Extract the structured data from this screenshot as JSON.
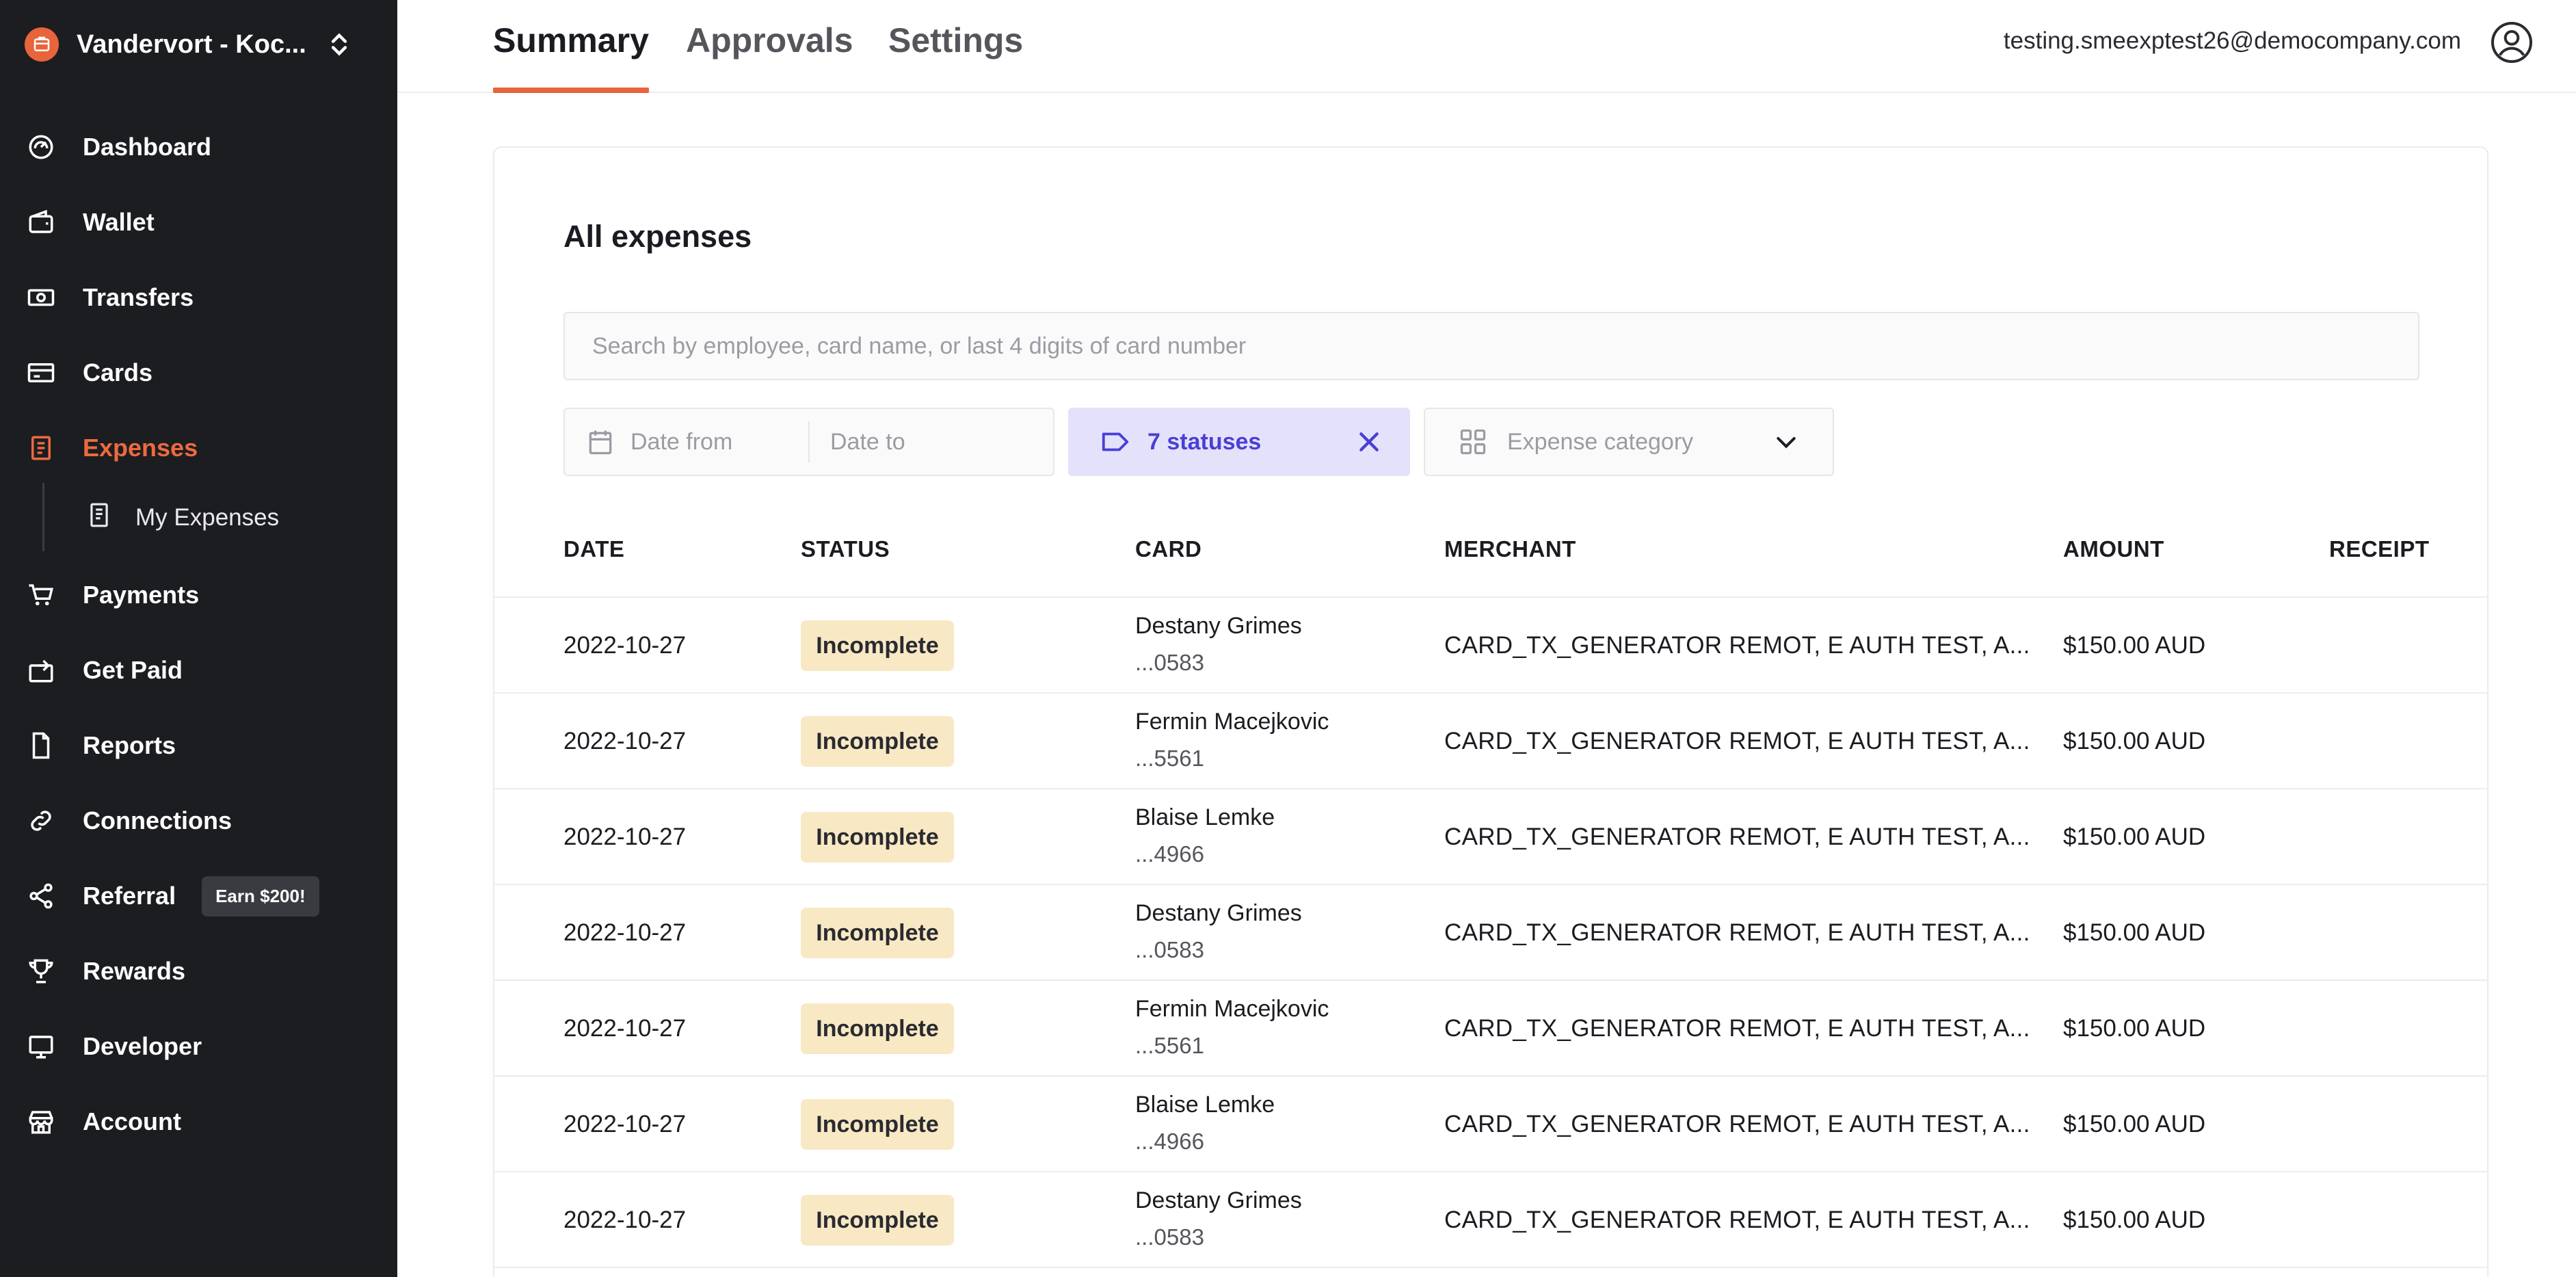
{
  "org": {
    "name": "Vandervort - Koc..."
  },
  "nav": [
    {
      "label": "Dashboard",
      "icon": "dashboard-icon"
    },
    {
      "label": "Wallet",
      "icon": "wallet-icon"
    },
    {
      "label": "Transfers",
      "icon": "transfers-icon"
    },
    {
      "label": "Cards",
      "icon": "cards-icon"
    },
    {
      "label": "Expenses",
      "icon": "expenses-icon",
      "active": true
    },
    {
      "label": "Payments",
      "icon": "cart-icon"
    },
    {
      "label": "Get Paid",
      "icon": "get-paid-icon"
    },
    {
      "label": "Reports",
      "icon": "reports-icon"
    },
    {
      "label": "Connections",
      "icon": "link-icon"
    },
    {
      "label": "Referral",
      "icon": "share-icon"
    },
    {
      "label": "Rewards",
      "icon": "trophy-icon"
    },
    {
      "label": "Developer",
      "icon": "monitor-icon"
    },
    {
      "label": "Account",
      "icon": "store-icon"
    }
  ],
  "subnav": {
    "my_expenses": "My Expenses"
  },
  "referral_badge": "Earn $200!",
  "tabs": {
    "summary": "Summary",
    "approvals": "Approvals",
    "settings": "Settings"
  },
  "user": {
    "email": "testing.smeexptest26@democompany.com"
  },
  "page": {
    "title": "All expenses"
  },
  "search": {
    "placeholder": "Search by employee, card name, or last 4 digits of card number"
  },
  "filters": {
    "date_from": "Date from",
    "date_to": "Date to",
    "statuses": "7 statuses",
    "category": "Expense category"
  },
  "table": {
    "headers": {
      "date": "DATE",
      "status": "STATUS",
      "card": "CARD",
      "merchant": "MERCHANT",
      "amount": "AMOUNT",
      "receipt": "RECEIPT"
    },
    "rows": [
      {
        "date": "2022-10-27",
        "status": "Incomplete",
        "card_name": "Destany Grimes",
        "card_num": "...0583",
        "merchant": "CARD_TX_GENERATOR REMOT, E AUTH TEST, A...",
        "amount": "$150.00 AUD"
      },
      {
        "date": "2022-10-27",
        "status": "Incomplete",
        "card_name": "Fermin Macejkovic",
        "card_num": "...5561",
        "merchant": "CARD_TX_GENERATOR REMOT, E AUTH TEST, A...",
        "amount": "$150.00 AUD"
      },
      {
        "date": "2022-10-27",
        "status": "Incomplete",
        "card_name": "Blaise Lemke",
        "card_num": "...4966",
        "merchant": "CARD_TX_GENERATOR REMOT, E AUTH TEST, A...",
        "amount": "$150.00 AUD"
      },
      {
        "date": "2022-10-27",
        "status": "Incomplete",
        "card_name": "Destany Grimes",
        "card_num": "...0583",
        "merchant": "CARD_TX_GENERATOR REMOT, E AUTH TEST, A...",
        "amount": "$150.00 AUD"
      },
      {
        "date": "2022-10-27",
        "status": "Incomplete",
        "card_name": "Fermin Macejkovic",
        "card_num": "...5561",
        "merchant": "CARD_TX_GENERATOR REMOT, E AUTH TEST, A...",
        "amount": "$150.00 AUD"
      },
      {
        "date": "2022-10-27",
        "status": "Incomplete",
        "card_name": "Blaise Lemke",
        "card_num": "...4966",
        "merchant": "CARD_TX_GENERATOR REMOT, E AUTH TEST, A...",
        "amount": "$150.00 AUD"
      },
      {
        "date": "2022-10-27",
        "status": "Incomplete",
        "card_name": "Destany Grimes",
        "card_num": "...0583",
        "merchant": "CARD_TX_GENERATOR REMOT, E AUTH TEST, A...",
        "amount": "$150.00 AUD"
      }
    ]
  },
  "colors": {
    "accent": "#e8643b",
    "sidebar": "#1c1d21",
    "status_bg": "#f8e8c4",
    "filter_active_bg": "#e4e2fa",
    "filter_active_fg": "#4a3fd6"
  }
}
